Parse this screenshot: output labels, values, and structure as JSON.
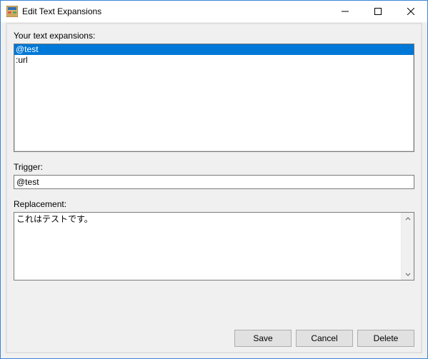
{
  "window": {
    "title": "Edit Text Expansions"
  },
  "labels": {
    "expansions": "Your text expansions:",
    "trigger": "Trigger:",
    "replacement": "Replacement:"
  },
  "expansions": {
    "items": [
      {
        "text": "@test",
        "selected": true
      },
      {
        "text": ":url",
        "selected": false
      }
    ]
  },
  "trigger": {
    "value": "@test"
  },
  "replacement": {
    "value": "これはテストです。"
  },
  "buttons": {
    "save": "Save",
    "cancel": "Cancel",
    "delete": "Delete"
  },
  "colors": {
    "selection": "#0078d7",
    "window_border": "#3a84d6"
  }
}
